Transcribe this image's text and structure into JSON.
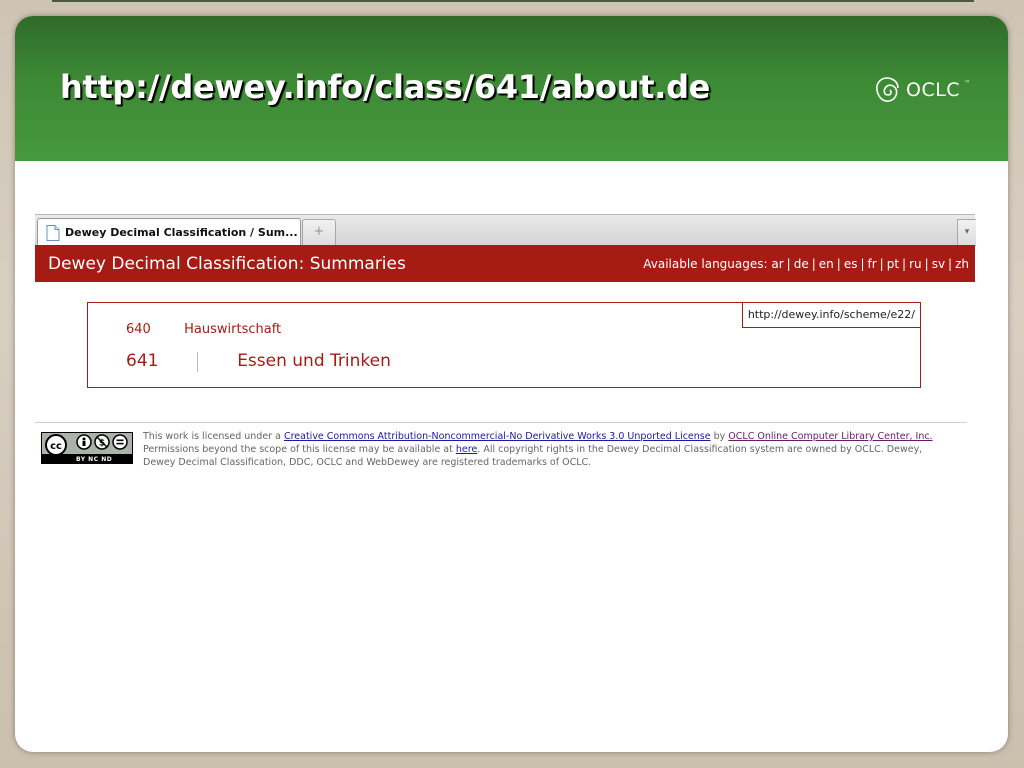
{
  "slide": {
    "title": "http://dewey.info/class/641/about.de",
    "logo_text": "OCLC",
    "logo_tm": "™"
  },
  "browser": {
    "tab_label": "Dewey Decimal Classification / Sum...",
    "new_tab_symbol": "+",
    "tab_list_symbol": "▾"
  },
  "ddc": {
    "header_title": "Dewey Decimal Classification: Summaries",
    "languages_prefix": "Available languages:",
    "languages": [
      "ar",
      "de",
      "en",
      "es",
      "fr",
      "pt",
      "ru",
      "sv",
      "zh"
    ],
    "scheme_uri": "http://dewey.info/scheme/e22/",
    "parent": {
      "notation": "640",
      "caption": "Hauswirtschaft"
    },
    "current": {
      "notation": "641",
      "caption": "Essen und Trinken"
    }
  },
  "footer": {
    "badge_strip": "BY  NC  ND",
    "license_intro": "This work is licensed under a ",
    "license_link": "Creative Commons Attribution-Noncommercial-No Derivative Works 3.0 Unported License",
    "by_text": " by ",
    "owner_link": "OCLC Online Computer Library Center, Inc.",
    "permissions_text": " Permissions beyond the scope of this license may be available at ",
    "here_link": "here",
    "rights_text": ". All copyright rights in the Dewey Decimal Classification system are owned by OCLC. Dewey, Dewey Decimal Classification, DDC, OCLC and WebDewey are registered trademarks of OCLC."
  },
  "colors": {
    "header_green": "#3d8a35",
    "ddc_red": "#a61c14",
    "link_blue": "#1a1aa6"
  }
}
